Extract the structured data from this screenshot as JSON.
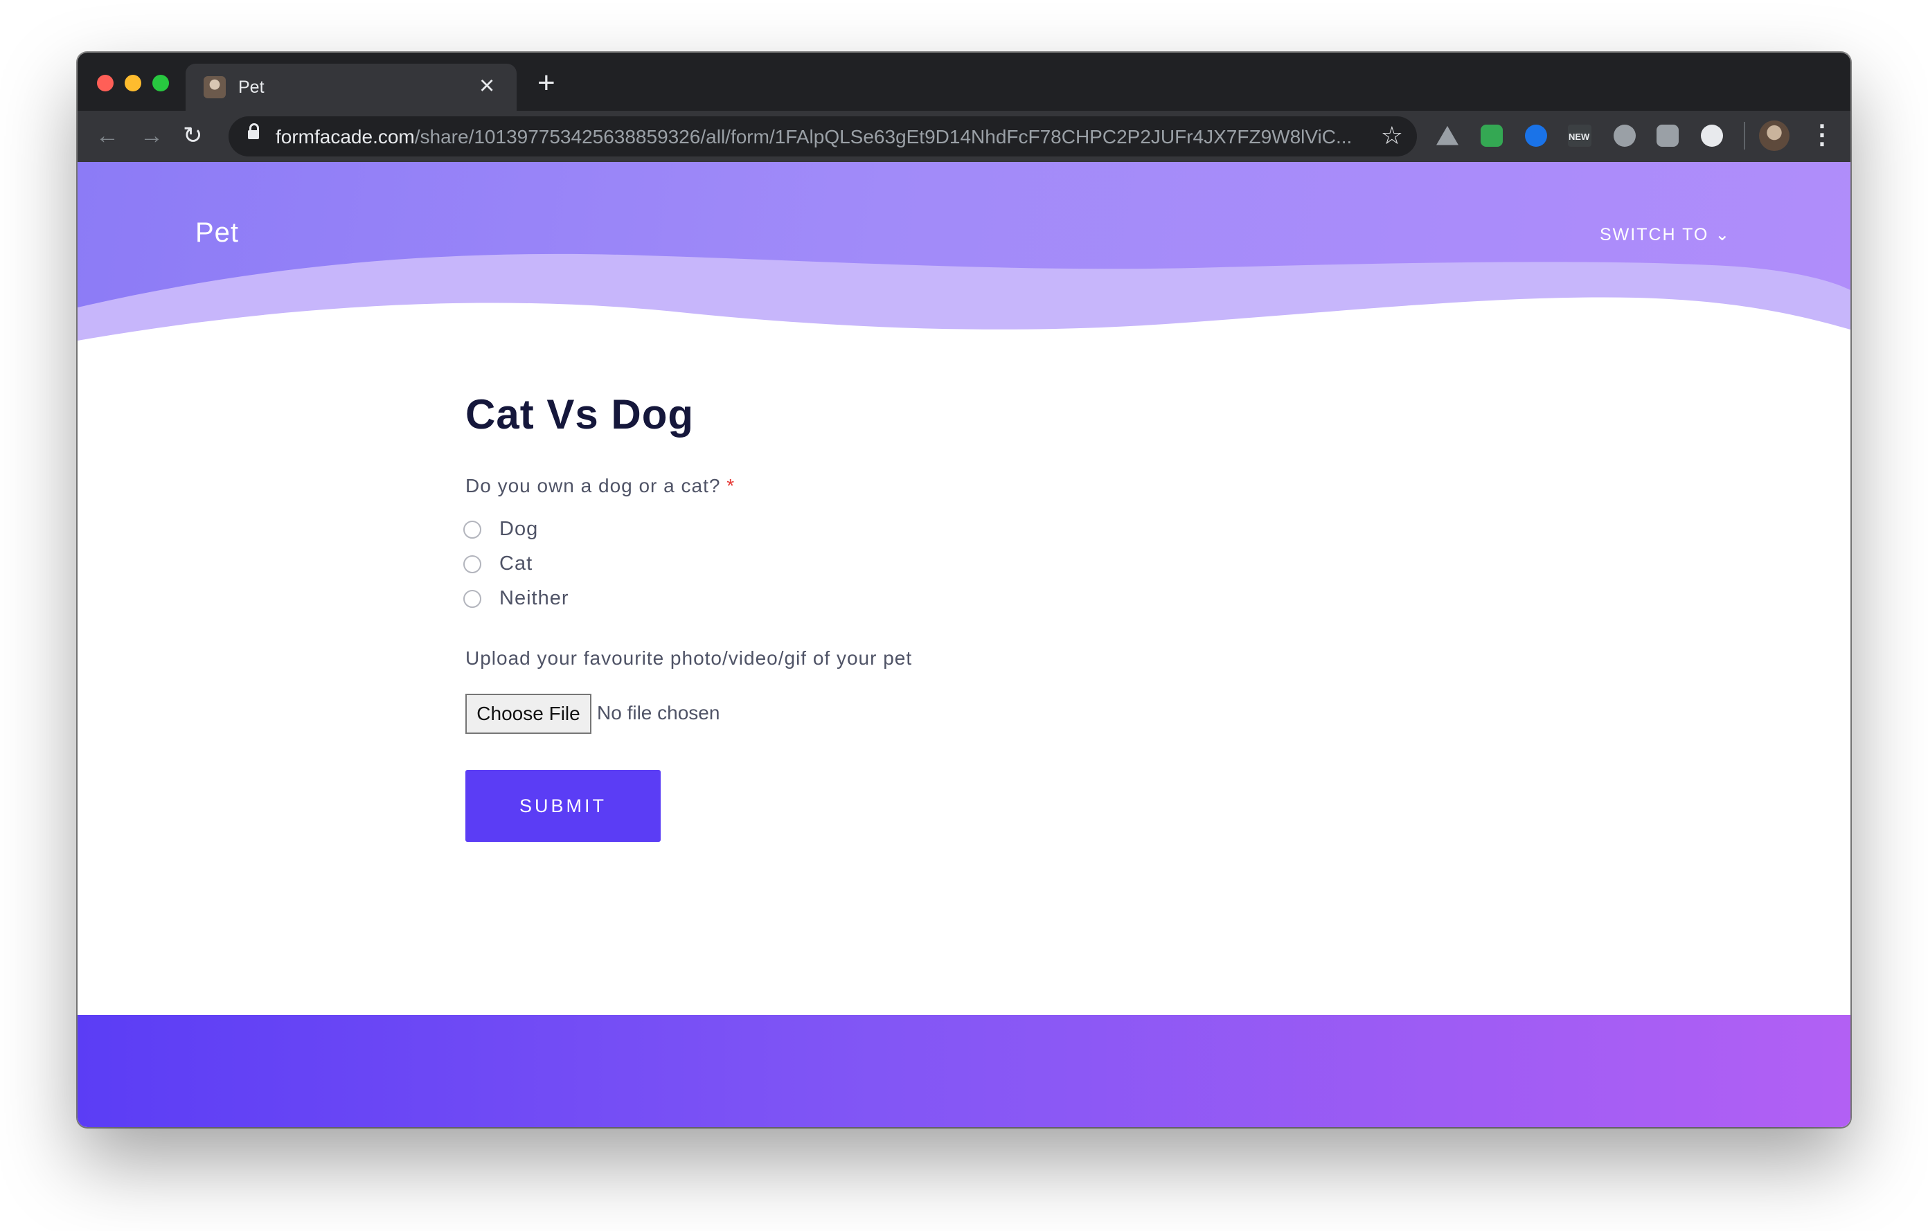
{
  "browser": {
    "tab_title": "Pet",
    "url_host": "formfacade.com",
    "url_path": "/share/101397753425638859326/all/form/1FAlpQLSe63gEt9D14NhdFcF78CHPC2P2JUFr4JX7FZ9W8lViC...",
    "extension_badge": "NEW"
  },
  "header": {
    "brand": "Pet",
    "switch_label": "SWITCH TO"
  },
  "form": {
    "title": "Cat Vs Dog",
    "question": "Do you own a dog or a cat?",
    "required_mark": "*",
    "options": [
      "Dog",
      "Cat",
      "Neither"
    ],
    "upload_label": "Upload your favourite photo/video/gif of your pet",
    "choose_file_label": "Choose File",
    "file_status": "No file chosen",
    "submit_label": "SUBMIT"
  },
  "colors": {
    "accent": "#5b3df5",
    "hero_start": "#8c7bf6",
    "hero_end": "#b08dfa",
    "footer_end": "#b260f4",
    "required": "#e53935"
  }
}
